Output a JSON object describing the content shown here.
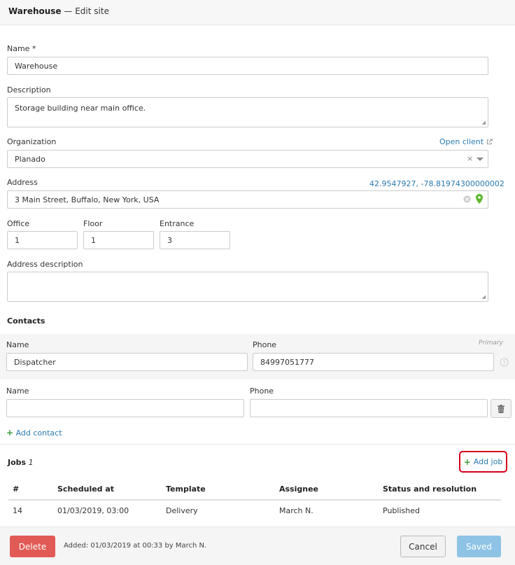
{
  "header": {
    "site_name": "Warehouse",
    "subtitle": "— Edit site"
  },
  "form": {
    "name_label": "Name *",
    "name_value": "Warehouse",
    "description_label": "Description",
    "description_value": "Storage building near main office.",
    "organization_label": "Organization",
    "open_client_label": "Open client",
    "organization_value": "Planado",
    "address_label": "Address",
    "coordinates": "42.9547927, -78.81974300000002",
    "address_value": "3 Main Street, Buffalo, New York, USA",
    "office_label": "Office",
    "office_value": "1",
    "floor_label": "Floor",
    "floor_value": "1",
    "entrance_label": "Entrance",
    "entrance_value": "3",
    "address_description_label": "Address description",
    "address_description_value": ""
  },
  "contacts": {
    "title": "Contacts",
    "primary_label": "Primary",
    "items": [
      {
        "name_label": "Name",
        "name_value": "Dispatcher",
        "phone_label": "Phone",
        "phone_value": "84997051777"
      },
      {
        "name_label": "Name",
        "name_value": "",
        "phone_label": "Phone",
        "phone_value": ""
      }
    ],
    "add_label": "Add contact"
  },
  "jobs": {
    "title": "Jobs",
    "count": "1",
    "add_label": "Add job",
    "columns": [
      "#",
      "Scheduled at",
      "Template",
      "Assignee",
      "Status and resolution"
    ],
    "rows": [
      {
        "id": "14",
        "scheduled": "01/03/2019, 03:00",
        "template": "Delivery",
        "assignee": "March N.",
        "status": "Published"
      }
    ]
  },
  "footer": {
    "delete_label": "Delete",
    "added_text": "Added: 01/03/2019 at 00:33 by March N.",
    "cancel_label": "Cancel",
    "saved_label": "Saved"
  },
  "colors": {
    "link": "#2a7ab0",
    "delete": "#e15a55",
    "saved": "#8ec3e6",
    "add_job_highlight": "#d4001a",
    "add_green": "#3ca33c",
    "pin_green": "#5cb82e"
  },
  "icons": [
    "external-link-icon",
    "clear-icon",
    "chevron-down-icon",
    "map-pin-icon",
    "info-icon",
    "trash-icon",
    "plus-icon"
  ]
}
